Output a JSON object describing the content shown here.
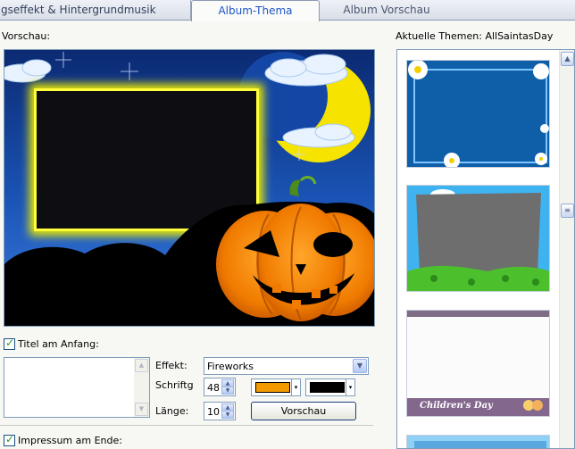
{
  "tabs": [
    {
      "label": "gseffekt & Hintergrundmusik"
    },
    {
      "label": "Album-Thema"
    },
    {
      "label": "Album Vorschau"
    }
  ],
  "preview": {
    "label": "Vorschau:"
  },
  "themes": {
    "label": "Aktuelle Themen: AllSaintasDay",
    "thumb4_caption": "Children's Day"
  },
  "title_start": {
    "label": "Titel am Anfang:",
    "checked": true
  },
  "controls": {
    "effect_label": "Effekt:",
    "effect_value": "Fireworks",
    "font_label": "Schriftg",
    "font_size": "48",
    "length_label": "Länge:",
    "length_value": "10",
    "preview_button": "Vorschau",
    "font_color": "#f29a00",
    "bg_color": "#000000"
  },
  "impressum_end": {
    "label": "Impressum am Ende:",
    "checked": true
  },
  "colors": {
    "accent": "#1d56c8",
    "border": "#7f9db9"
  }
}
